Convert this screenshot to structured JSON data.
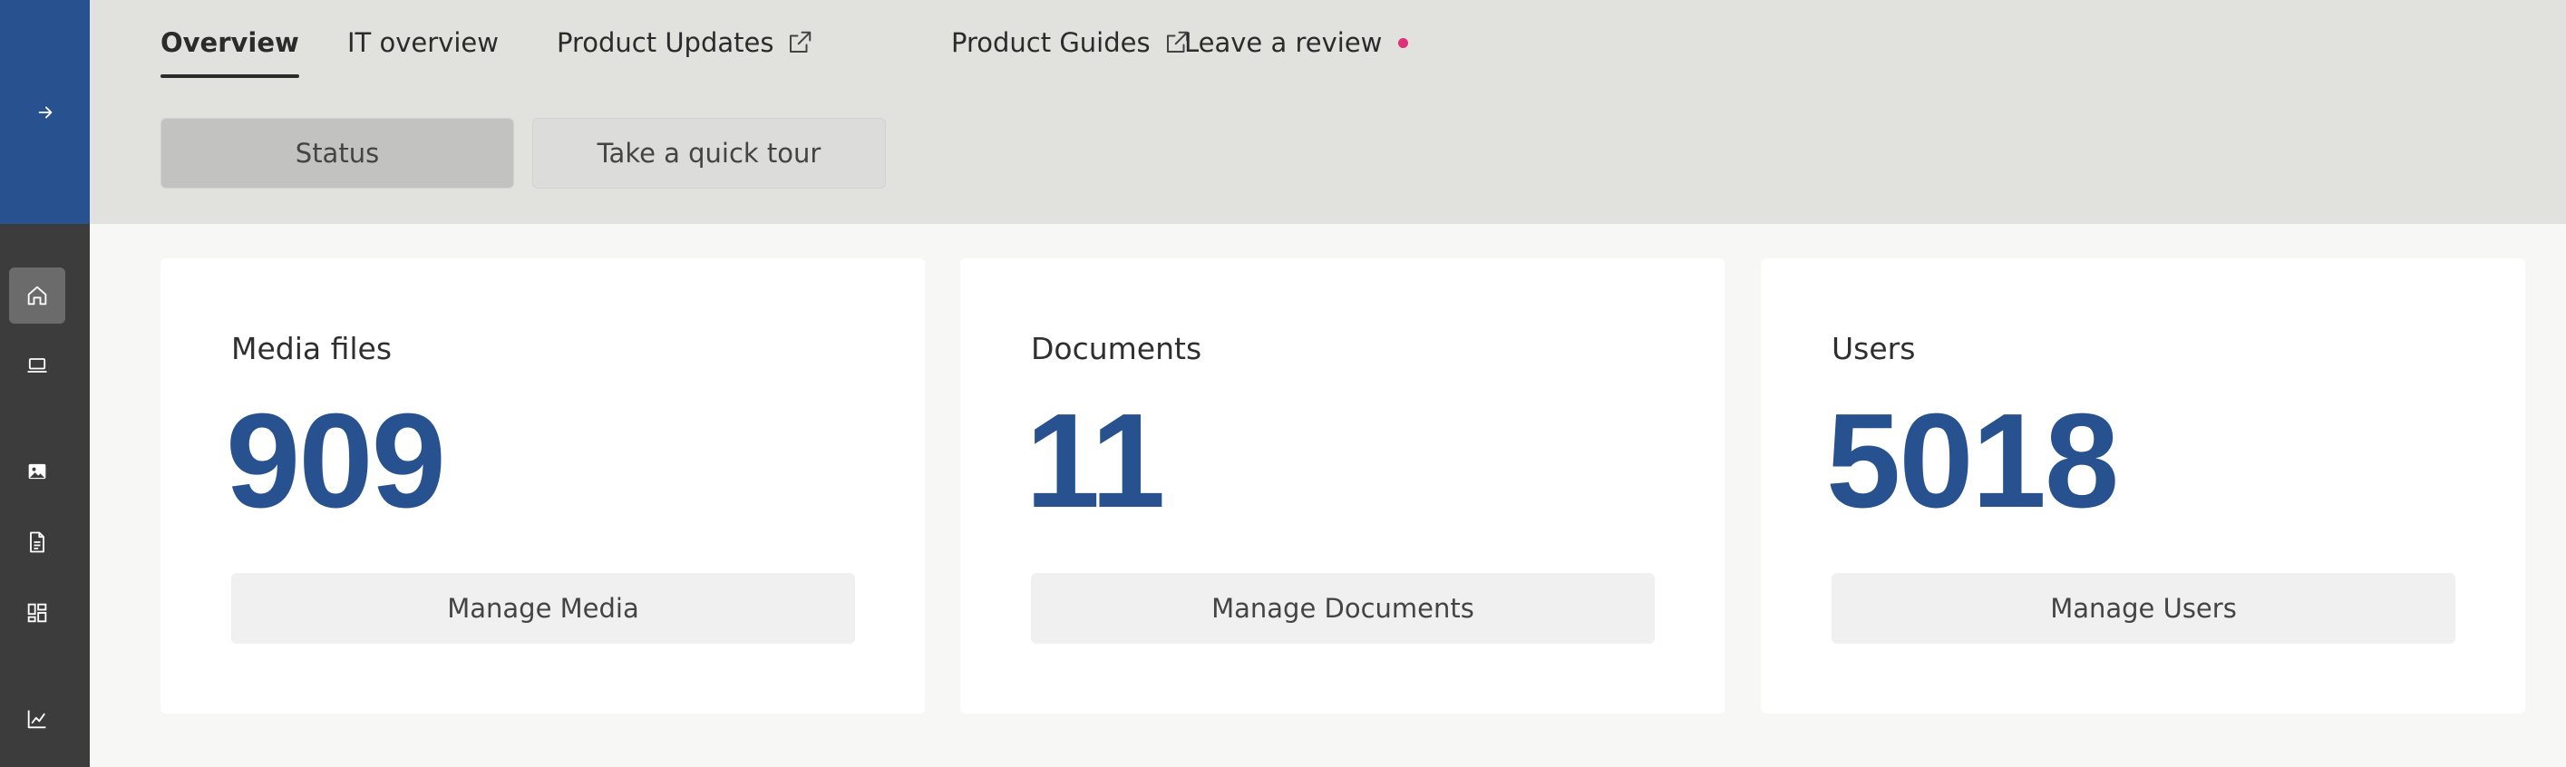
{
  "sidebar": {
    "toggle_icon": "arrow-right-icon",
    "items": [
      {
        "icon": "home-icon",
        "active": true
      },
      {
        "icon": "laptop-icon",
        "active": false
      },
      {
        "icon": "image-icon",
        "active": false
      },
      {
        "icon": "document-icon",
        "active": false
      },
      {
        "icon": "dashboard-layout-icon",
        "active": false
      },
      {
        "icon": "line-chart-icon",
        "active": false
      }
    ]
  },
  "tabs": [
    {
      "label": "Overview",
      "active": true
    },
    {
      "label": "IT overview",
      "active": false
    },
    {
      "label": "Product Updates",
      "external": true
    },
    {
      "label": "Product Guides",
      "external": true
    },
    {
      "label": "Leave a review",
      "notification_dot": true
    }
  ],
  "header_buttons": {
    "status": "Status",
    "tour": "Take a quick tour"
  },
  "cards": [
    {
      "title": "Media files",
      "count": "909",
      "button": "Manage Media"
    },
    {
      "title": "Documents",
      "count": "11",
      "button": "Manage Documents"
    },
    {
      "title": "Users",
      "count": "5018",
      "button": "Manage Users"
    }
  ],
  "colors": {
    "brand": "#27518f",
    "sidebar": "#3c3c3c",
    "header_bg": "#e1e1de",
    "notification_dot": "#e0307a"
  }
}
